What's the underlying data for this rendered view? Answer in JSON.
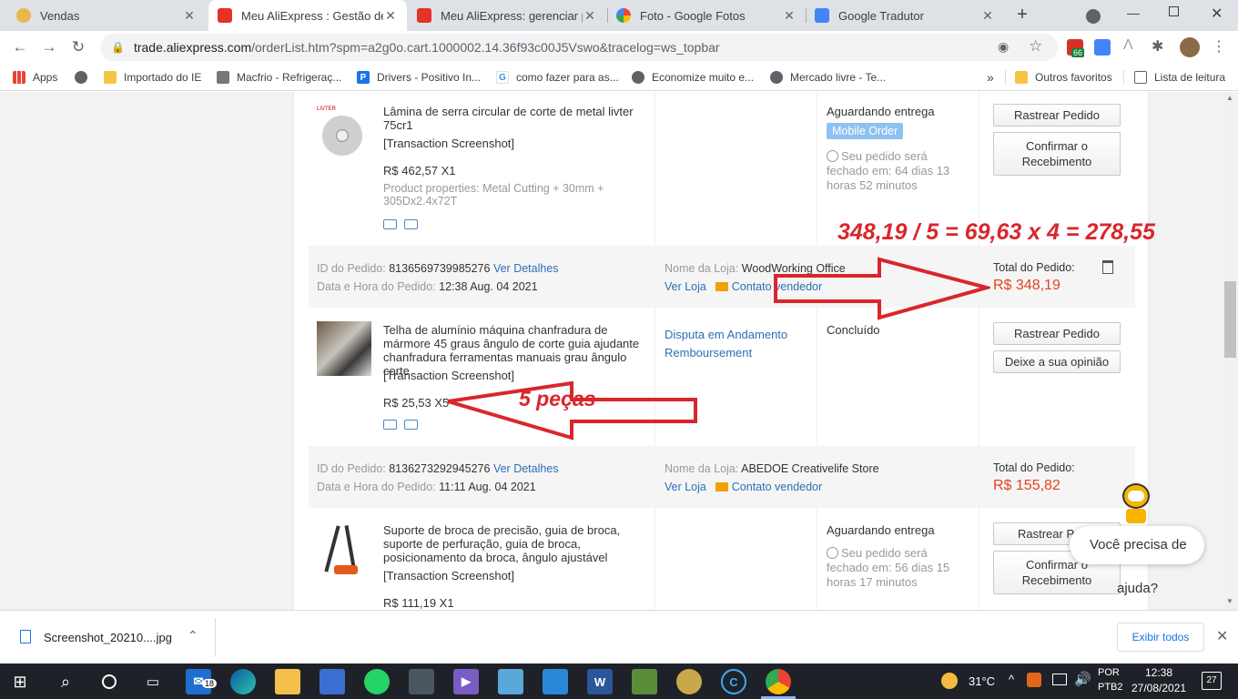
{
  "tabs": [
    {
      "title": "Vendas"
    },
    {
      "title": "Meu AliExpress : Gestão de p"
    },
    {
      "title": "Meu AliExpress: gerenciar pe"
    },
    {
      "title": "Foto - Google Fotos"
    },
    {
      "title": "Google Tradutor"
    }
  ],
  "url": {
    "host": "trade.aliexpress.com",
    "path": "/orderList.htm?spm=a2g0o.cart.1000002.14.36f93c00J5Vswo&tracelog=ws_topbar"
  },
  "extension_badge": "66",
  "bookmarks": [
    {
      "label": "Apps"
    },
    {
      "label": ""
    },
    {
      "label": "Importado do IE"
    },
    {
      "label": "Macfrio - Refrigeraç..."
    },
    {
      "label": "Drivers - Positivo In..."
    },
    {
      "label": "como fazer para as..."
    },
    {
      "label": "Economize muito e..."
    },
    {
      "label": "Mercado livre - Te..."
    }
  ],
  "bookmarks_right": {
    "more": "»",
    "other": "Outros favoritos",
    "reading": "Lista de leitura"
  },
  "order1_item": {
    "thumb_text": "LIVTER",
    "title": "Lâmina de serra circular de corte de metal livter 75cr1",
    "screenshot": "[Transaction Screenshot]",
    "price": "R$ 462,57 X1",
    "properties": "Product properties: Metal Cutting + 30mm + 305Dx2.4x72T",
    "status": "Aguardando entrega",
    "badge": "Mobile Order",
    "closing": "Seu pedido será fechado em: 64 dias 13 horas 52 minutos",
    "btn1": "Rastrear Pedido",
    "btn2": "Confirmar o Recebimento"
  },
  "order2": {
    "id_label": "ID do Pedido:",
    "id": "8136569739985276",
    "details": "Ver Detalhes",
    "date_label": "Data e Hora do Pedido:",
    "date": "12:38 Aug. 04 2021",
    "store_label": "Nome da Loja:",
    "store": "WoodWorking Office",
    "view_store": "Ver Loja",
    "contact": "Contato vendedor",
    "total_label": "Total do Pedido:",
    "total": "R$ 348,19",
    "item_title": "Telha de alumínio máquina chanfradura de mármore 45 graus ângulo de corte guia ajudante chanfradura ferramentas manuais grau ângulo corte",
    "screenshot": "[Transaction Screenshot]",
    "price": "R$ 25,53 X5",
    "dispute": "Disputa em Andamento",
    "reimbursement": "Rembo ursement",
    "reimbursement_text": "Remboursement",
    "status": "Concluído",
    "btn1": "Rastrear Pedido",
    "btn2": "Deixe a sua opinião"
  },
  "order3": {
    "id_label": "ID do Pedido:",
    "id": "8136273292945276",
    "details": "Ver Detalhes",
    "date_label": "Data e Hora do Pedido:",
    "date": "11:11 Aug. 04 2021",
    "store_label": "Nome da Loja:",
    "store": "ABEDOE Creativelife Store",
    "view_store": "Ver Loja",
    "contact": "Contato vendedor",
    "total_label": "Total do Pedido:",
    "total": "R$ 155,82",
    "item_title": "Suporte de broca de precisão, guia de broca, suporte de perfuração, guia de broca, posicionamento da broca, ângulo ajustável",
    "screenshot": "[Transaction Screenshot]",
    "price": "R$ 111,19 X1",
    "status": "Aguardando entrega",
    "closing": "Seu pedido será fechado em: 56 dias 15 horas 17 minutos",
    "btn1": "Rastrear Pe",
    "btn2": "Confirmar o Recebimento"
  },
  "annotations": {
    "calc": "348,19 / 5 = 69,63 x 4 = 278,55",
    "pieces": "5 peças"
  },
  "chat": {
    "line1": "Você precisa de",
    "line2": "ajuda?"
  },
  "download": {
    "file": "Screenshot_20210....jpg",
    "show_all": "Exibir todos"
  },
  "taskbar": {
    "mail_badge": "18",
    "weather": "31°C",
    "lang1": "POR",
    "lang2": "PTB2",
    "time": "12:38",
    "date": "27/08/2021",
    "notif": "27"
  }
}
